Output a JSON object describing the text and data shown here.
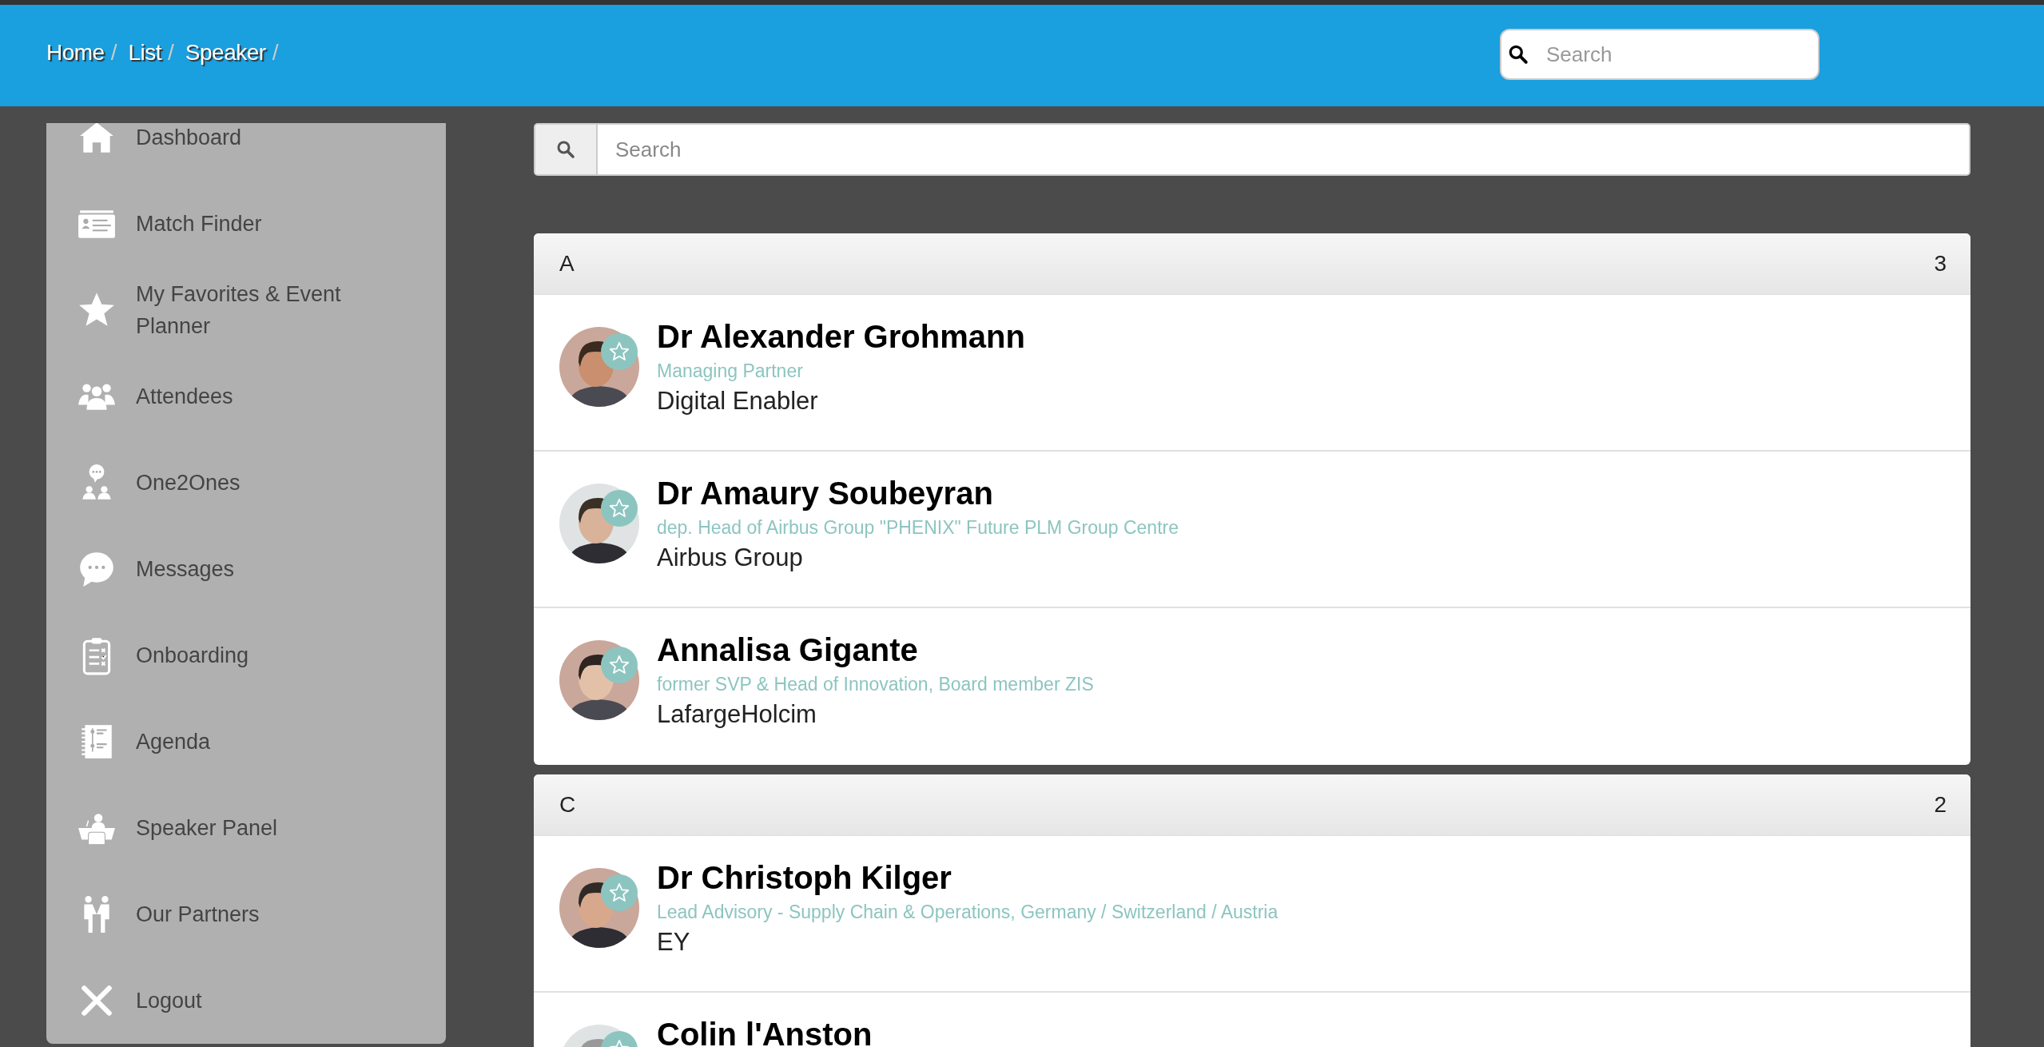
{
  "breadcrumb": {
    "separator": "/",
    "items": [
      "Home",
      "List",
      "Speaker"
    ]
  },
  "header_search": {
    "placeholder": "Search"
  },
  "sidebar": {
    "items": [
      {
        "label": "Dashboard"
      },
      {
        "label": "Match Finder"
      },
      {
        "label": "My Favorites & Event Planner"
      },
      {
        "label": "Attendees"
      },
      {
        "label": "One2Ones"
      },
      {
        "label": "Messages"
      },
      {
        "label": "Onboarding"
      },
      {
        "label": "Agenda"
      },
      {
        "label": "Speaker Panel"
      },
      {
        "label": "Our Partners"
      },
      {
        "label": "Logout"
      }
    ]
  },
  "list_search": {
    "placeholder": "Search"
  },
  "sections": [
    {
      "letter": "A",
      "count": "3",
      "speakers": [
        {
          "name": "Dr Alexander Grohmann",
          "title": "Managing Partner",
          "company": "Digital Enabler"
        },
        {
          "name": "Dr Amaury Soubeyran",
          "title": "dep. Head of Airbus Group \"PHENIX\" Future PLM Group Centre",
          "company": "Airbus Group"
        },
        {
          "name": "Annalisa Gigante",
          "title": "former SVP & Head of Innovation, Board member ZIS",
          "company": "LafargeHolcim"
        }
      ]
    },
    {
      "letter": "C",
      "count": "2",
      "speakers": [
        {
          "name": "Dr Christoph Kilger",
          "title": "Lead Advisory - Supply Chain & Operations, Germany / Switzerland / Austria",
          "company": "EY"
        },
        {
          "name": "Colin l'Anston"
        }
      ]
    }
  ]
}
